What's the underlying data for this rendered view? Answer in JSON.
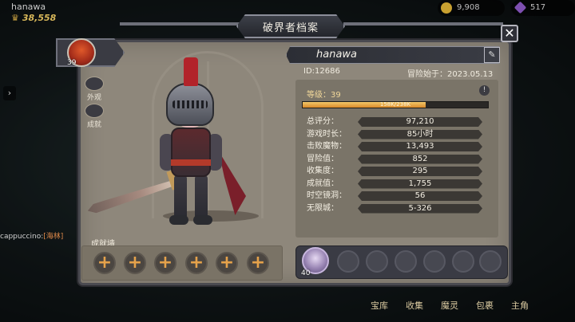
{
  "hud": {
    "player_name": "hanawa",
    "power": "38,558",
    "gold": "9,908",
    "gems": "517",
    "chat_user": "cappuccino:",
    "chat_tag": "[海林]",
    "bottom_nav": [
      "宝库",
      "收集",
      "魔灵",
      "包裹",
      "主角"
    ]
  },
  "dialog": {
    "title": "破界者档案",
    "close_label": "✕"
  },
  "profile": {
    "portrait_level": "39",
    "side_tools": [
      "外观",
      "成就"
    ],
    "name": "hanawa",
    "id": "ID:12686",
    "adventure_start": "冒险始于：2023.05.13",
    "level_label": "等级：39",
    "xp_text": "158K/238K",
    "xp_fraction": 0.664
  },
  "stats": [
    {
      "label": "总评分：",
      "value": "97,210"
    },
    {
      "label": "游戏时长：",
      "value": "85小时"
    },
    {
      "label": "击败魔物：",
      "value": "13,493"
    },
    {
      "label": "冒险值：",
      "value": "852"
    },
    {
      "label": "收集度：",
      "value": "295"
    },
    {
      "label": "成就值：",
      "value": "1,755"
    },
    {
      "label": "时空镜洞：",
      "value": "56"
    },
    {
      "label": "无限城：",
      "value": "5-326"
    }
  ],
  "achievement_wall": {
    "label": "成就墙",
    "slot_symbol": "+"
  },
  "companions": {
    "level": "40"
  }
}
